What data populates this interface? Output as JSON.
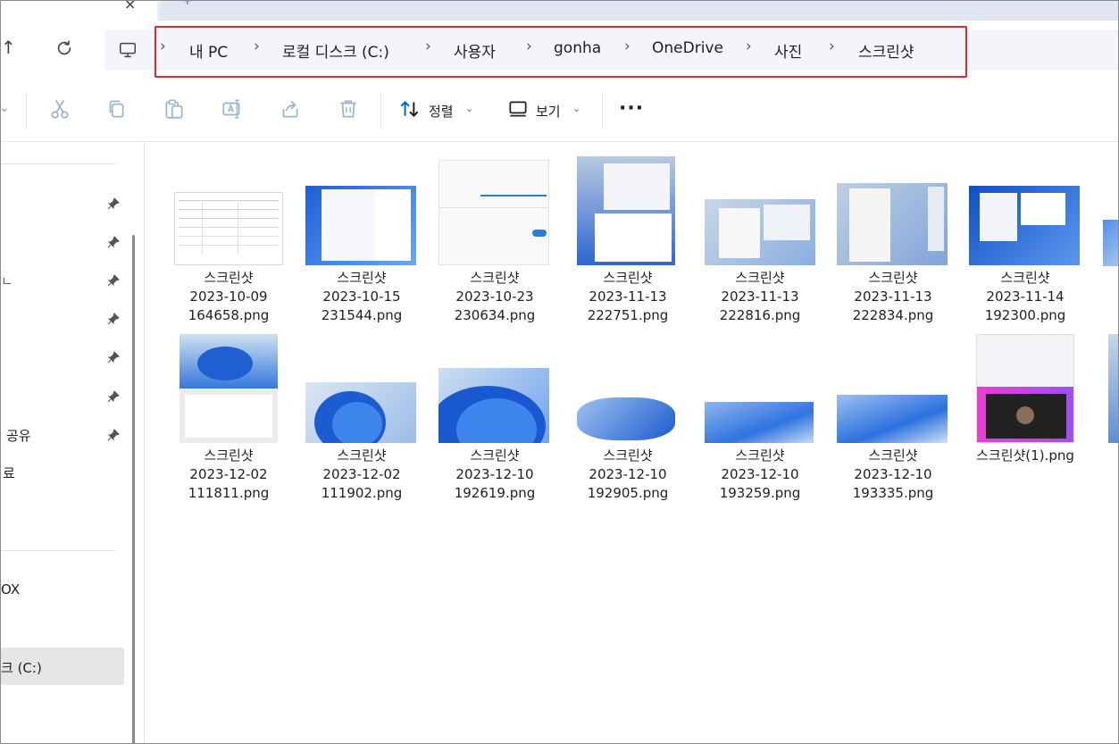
{
  "address_bar": {
    "breadcrumbs": [
      "내 PC",
      "로컬 디스크 (C:)",
      "사용자",
      "gonha",
      "OneDrive",
      "사진",
      "스크린샷"
    ]
  },
  "toolbar": {
    "sort_label": "정렬",
    "view_label": "보기"
  },
  "nav_pane": {
    "items": [
      {
        "label": "ㄴ"
      },
      {
        "label": "공유"
      },
      {
        "label": "료"
      },
      {
        "label": "OX"
      },
      {
        "label": "크 (C:)"
      }
    ]
  },
  "files": [
    {
      "line1": "스크린샷",
      "line2": "2023-10-09",
      "line3": "164658.png"
    },
    {
      "line1": "스크린샷",
      "line2": "2023-10-15",
      "line3": "231544.png"
    },
    {
      "line1": "스크린샷",
      "line2": "2023-10-23",
      "line3": "230634.png"
    },
    {
      "line1": "스크린샷",
      "line2": "2023-11-13",
      "line3": "222751.png"
    },
    {
      "line1": "스크린샷",
      "line2": "2023-11-13",
      "line3": "222816.png"
    },
    {
      "line1": "스크린샷",
      "line2": "2023-11-13",
      "line3": "222834.png"
    },
    {
      "line1": "스크린샷",
      "line2": "2023-11-14",
      "line3": "192300.png"
    },
    {
      "line1": "스크린샷",
      "line2": "2023-12-02",
      "line3": "111811.png"
    },
    {
      "line1": "스크린샷",
      "line2": "2023-12-02",
      "line3": "111902.png"
    },
    {
      "line1": "스크린샷",
      "line2": "2023-12-10",
      "line3": "192619.png"
    },
    {
      "line1": "스크린샷",
      "line2": "2023-12-10",
      "line3": "192905.png"
    },
    {
      "line1": "스크린샷",
      "line2": "2023-12-10",
      "line3": "193259.png"
    },
    {
      "line1": "스크린샷",
      "line2": "2023-12-10",
      "line3": "193335.png"
    },
    {
      "line1": "스크린샷(1).png",
      "line2": "",
      "line3": ""
    }
  ],
  "colors": {
    "highlight_outline": "#e8232e",
    "accent": "#0067c0",
    "selected_bg": "#e5e5e5"
  }
}
